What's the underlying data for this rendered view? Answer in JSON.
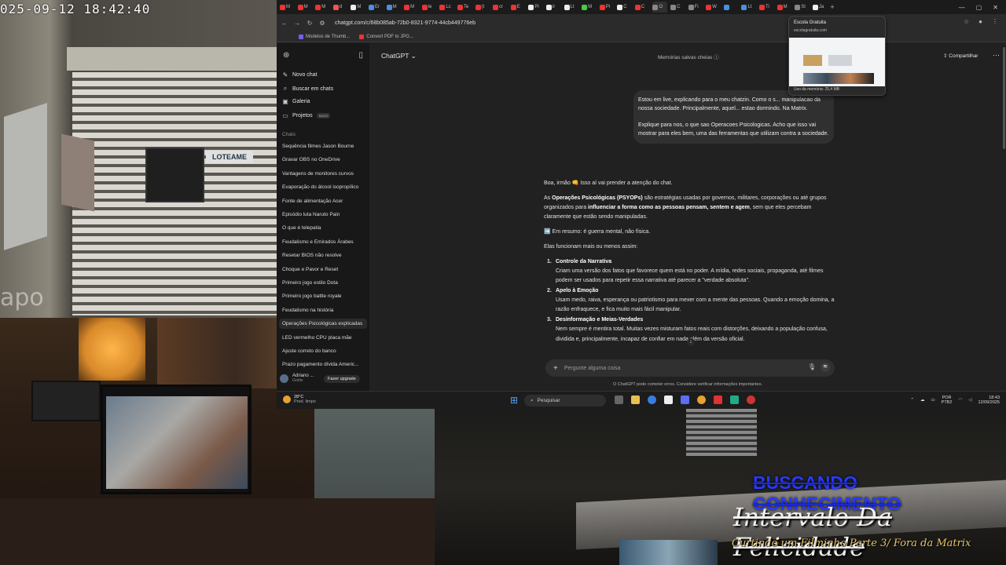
{
  "camera": {
    "timestamp": "025-09-12  18:42:40",
    "watermark": "apo",
    "sign": "LOTEAME"
  },
  "overlay": {
    "line1": "BUSCANDO CONHECIMENTO",
    "line2": "Intervalo Da Felicidade",
    "line3": "Curtindo um Filminho Parte 3/ Fora da Matrix"
  },
  "browser": {
    "url": "chatgpt.com/c/68b085ab-72b0-8321-9774-44cb449776eb",
    "tabs": [
      {
        "label": "M",
        "color": "#e33"
      },
      {
        "label": "M",
        "color": "#e33"
      },
      {
        "label": "M",
        "color": "#e33"
      },
      {
        "label": "d",
        "color": "#e55"
      },
      {
        "label": "M",
        "color": "#eee"
      },
      {
        "label": "Er",
        "color": "#4a8fe0"
      },
      {
        "label": "M",
        "color": "#4a8fe0"
      },
      {
        "label": "M",
        "color": "#e33"
      },
      {
        "label": "le",
        "color": "#e33"
      },
      {
        "label": "Lc",
        "color": "#e33"
      },
      {
        "label": "Te",
        "color": "#e33"
      },
      {
        "label": "(t",
        "color": "#e33"
      },
      {
        "label": "cr",
        "color": "#e33"
      },
      {
        "label": "E",
        "color": "#e33"
      },
      {
        "label": "Pl",
        "color": "#eee"
      },
      {
        "label": "ir",
        "color": "#eee"
      },
      {
        "label": "Lt",
        "color": "#eee"
      },
      {
        "label": "M",
        "color": "#4c4"
      },
      {
        "label": "Pl",
        "color": "#e33"
      },
      {
        "label": "C",
        "color": "#eee"
      },
      {
        "label": "C",
        "color": "#e33"
      },
      {
        "label": "O",
        "color": "#888"
      },
      {
        "label": "C",
        "color": "#888"
      },
      {
        "label": "Fi",
        "color": "#888"
      },
      {
        "label": "W",
        "color": "#e33"
      },
      {
        "label": "",
        "color": "#4a8fe0"
      },
      {
        "label": "Lt",
        "color": "#4a8fe0"
      },
      {
        "label": "Ti",
        "color": "#e33"
      },
      {
        "label": "M",
        "color": "#e33"
      },
      {
        "label": "St",
        "color": "#888"
      },
      {
        "label": "Ja",
        "color": "#eee"
      }
    ],
    "bookmarks": [
      {
        "label": "Modelos de Thumb...",
        "color": "#7a5af0"
      },
      {
        "label": "Convert PDF to JPG...",
        "color": "#e33"
      }
    ],
    "tab_popup": {
      "title": "Escola Gratuita",
      "domain": "escolagratuita.com",
      "memory": "Uso da memória: 25,4 MB"
    }
  },
  "sidebar": {
    "items": [
      {
        "label": "Novo chat",
        "icon": "edit-icon"
      },
      {
        "label": "Buscar em chats",
        "icon": "search-icon"
      },
      {
        "label": "Galeria",
        "icon": "image-icon"
      },
      {
        "label": "Projetos",
        "icon": "folder-icon",
        "badge": "NOVO"
      }
    ],
    "chats_label": "Chats",
    "chats": [
      "Sequência filmes Jason Bourne",
      "Gravar OBS no OneDrive",
      "Vantagens de monitores curvos",
      "Evaporação do álcool isopropílico",
      "Fonte de alimentação Acer",
      "Episódio luta Naruto Pain",
      "O que é telepatia",
      "Feudalismo e Emirados Árabes",
      "Resetar BIOS não resolve",
      "Choque e Pavor e Reset",
      "Primeiro jogo estilo Dota",
      "Primeiro jogo battle royale",
      "Feudalismo na história",
      "Operações Psicológicas explicadas",
      "LED vermelho CPU placa mãe",
      "Ajuste correto do banco",
      "Prazo pagamento dívida Americ..."
    ],
    "user_name": "Adriano ...",
    "user_plan": "Grátis",
    "upgrade": "Fazer upgrade"
  },
  "header": {
    "model": "ChatGPT",
    "memory": "Memórias salvas cheias",
    "share": "Compartilhar"
  },
  "conversation": {
    "user_p1": "Estou em live, explicando para o meu chatzin. Como o s... manipulacao da nossa sociedade. Principalmente, aquel... estao dormindo. Na Matrix.",
    "user_p2": "Explique para nos, o que sao Operacoes Psicologicas. Acho que isso vai mostrar para eles bem, uma das ferramentas que utilizam contra a sociedade.",
    "intro": "Boa, irmão 👊 Isso aí vai prender a atenção do chat.",
    "def_pre": "As ",
    "def_bold": "Operações Psicológicas (PSYOPs)",
    "def_mid": " são estratégias usadas por governos, militares, corporações ou até grupos organizados para ",
    "def_bold2": "influenciar a forma como as pessoas pensam, sentem e agem",
    "def_post": ", sem que eles percebam claramente que estão sendo manipuladas.",
    "summary": "➡️ Em resumo: é guerra mental, não física.",
    "how": "Elas funcionam mais ou menos assim:",
    "list": [
      {
        "num": "1.",
        "title": "Controle da Narrativa",
        "desc": "Criam uma versão dos fatos que favorece quem está no poder. A mídia, redes sociais, propaganda, até filmes podem ser usados para repetir essa narrativa até parecer a \"verdade absoluta\"."
      },
      {
        "num": "2.",
        "title": "Apelo à Emoção",
        "desc": "Usam medo, raiva, esperança ou patriotismo para mexer com a mente das pessoas. Quando a emoção domina, a razão enfraquece, e fica muito mais fácil manipular."
      },
      {
        "num": "3.",
        "title": "Desinformação e Meias-Verdades",
        "desc": "Nem sempre é mentira total. Muitas vezes misturam fatos reais com distorções, deixando a população confusa, dividida e, principalmente, incapaz de confiar em nada além da versão oficial."
      }
    ],
    "composer_placeholder": "Pergunte alguma coisa",
    "disclaimer": "O ChatGPT pode cometer erros. Considere verificar informações importantes."
  },
  "taskbar": {
    "temp": "28°C",
    "weather": "Pred. limpo",
    "search": "Pesquisar",
    "lang1": "POR",
    "lang2": "PTB2",
    "time": "18:43",
    "date": "12/09/2025"
  }
}
